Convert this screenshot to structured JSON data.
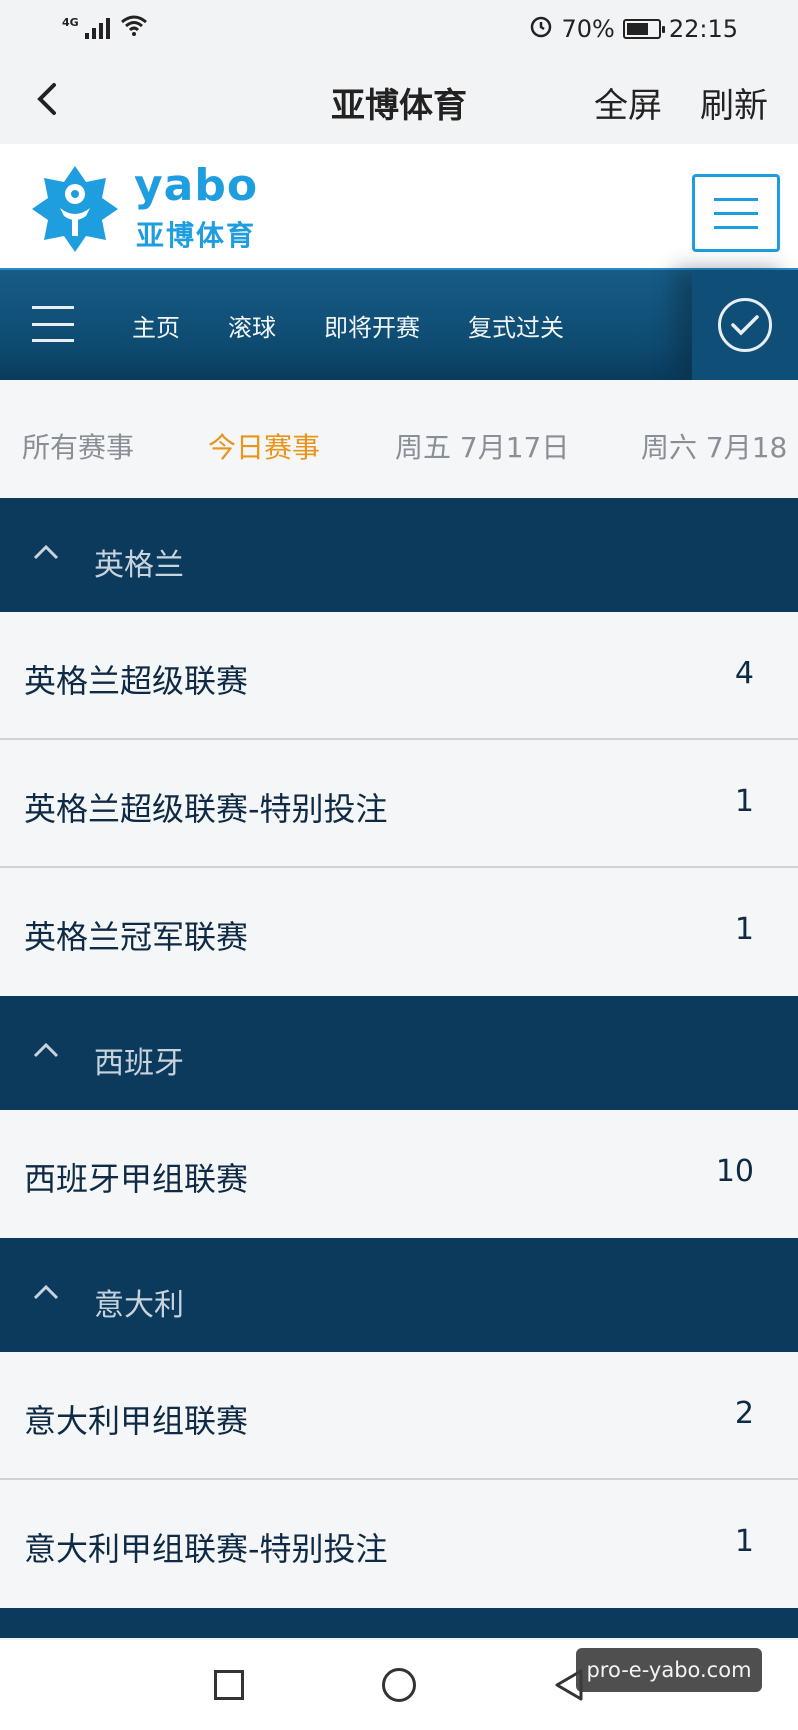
{
  "status_bar": {
    "signal_tag": "4G",
    "battery_percent": "70%",
    "battery_level": 0.7,
    "time": "22:15",
    "icons": [
      "signal-icon",
      "wifi-icon",
      "alarm-icon",
      "battery-icon"
    ]
  },
  "title_bar": {
    "back_icon": "chevron-left-icon",
    "title": "亚博体育",
    "fullscreen_label": "全屏",
    "refresh_label": "刷新"
  },
  "brand": {
    "logo_word": "yabo",
    "logo_sub": "亚博体育",
    "logo_icon": "soccer-star-icon",
    "menu_icon": "hamburger-icon",
    "accent_color": "#1e9ddf"
  },
  "nav": {
    "menu_icon": "hamburger-icon",
    "items": [
      {
        "label": "主页"
      },
      {
        "label": "滚球"
      },
      {
        "label": "即将开赛"
      },
      {
        "label": "复式过关"
      }
    ],
    "check_icon": "check-circle-icon",
    "bg_color": "#0e4a70"
  },
  "date_tabs": [
    {
      "label": "所有赛事",
      "active": false
    },
    {
      "label": "今日赛事",
      "active": true
    },
    {
      "label": "周五 7月17日",
      "active": false
    },
    {
      "label": "周六 7月18",
      "active": false
    }
  ],
  "active_tab_color": "#e8961a",
  "groups": [
    {
      "country": "英格兰",
      "leagues": [
        {
          "name": "英格兰超级联赛",
          "count": "4"
        },
        {
          "name": "英格兰超级联赛-特别投注",
          "count": "1"
        },
        {
          "name": "英格兰冠军联赛",
          "count": "1"
        }
      ]
    },
    {
      "country": "西班牙",
      "leagues": [
        {
          "name": "西班牙甲组联赛",
          "count": "10"
        }
      ]
    },
    {
      "country": "意大利",
      "leagues": [
        {
          "name": "意大利甲组联赛",
          "count": "2"
        },
        {
          "name": "意大利甲组联赛-特别投注",
          "count": "1"
        }
      ]
    }
  ],
  "bottom_nav": {
    "icons": [
      "square-recents-icon",
      "circle-home-icon",
      "triangle-back-icon"
    ]
  },
  "watermark": "pro-e-yabo.com"
}
